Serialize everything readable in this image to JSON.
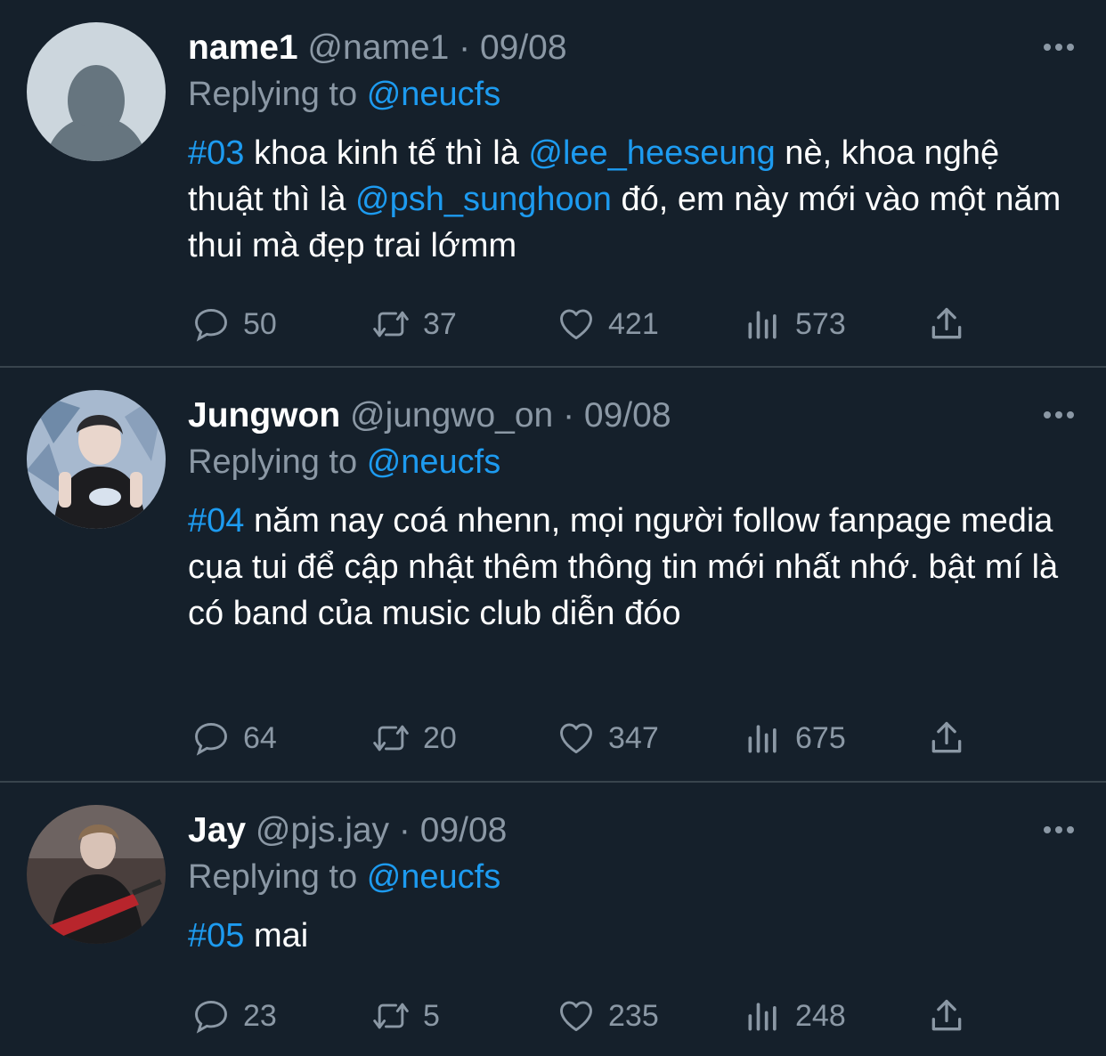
{
  "tweets": [
    {
      "name": "name1",
      "handle": "@name1",
      "separator": "·",
      "date": "09/08",
      "replying_prefix": "Replying to",
      "replying_to": "@neucfs",
      "body": [
        {
          "text": "#03",
          "link": true
        },
        {
          "text": " khoa kinh tế thì là ",
          "link": false
        },
        {
          "text": "@lee_heeseung",
          "link": true
        },
        {
          "text": " nè, khoa nghệ thuật thì là ",
          "link": false
        },
        {
          "text": "@psh_sunghoon",
          "link": true
        },
        {
          "text": " đó, em này mới vào một năm thui mà đẹp trai lớmm",
          "link": false
        }
      ],
      "stats": {
        "replies": "50",
        "retweets": "37",
        "likes": "421",
        "views": "573"
      }
    },
    {
      "name": "Jungwon",
      "handle": "@jungwo_on",
      "separator": "·",
      "date": "09/08",
      "replying_prefix": "Replying to",
      "replying_to": "@neucfs",
      "body": [
        {
          "text": "#04",
          "link": true
        },
        {
          "text": " năm nay coá nhenn, mọi người follow fanpage media cụa tui để cập nhật thêm thông tin mới nhất nhớ. bật mí là có band của music club diễn đóo",
          "link": false
        }
      ],
      "stats": {
        "replies": "64",
        "retweets": "20",
        "likes": "347",
        "views": "675"
      }
    },
    {
      "name": "Jay",
      "handle": "@pjs.jay",
      "separator": "·",
      "date": "09/08",
      "replying_prefix": "Replying to",
      "replying_to": "@neucfs",
      "body": [
        {
          "text": "#05",
          "link": true
        },
        {
          "text": " mai",
          "link": false
        }
      ],
      "stats": {
        "replies": "23",
        "retweets": "5",
        "likes": "235",
        "views": "248"
      }
    }
  ],
  "icons": {
    "reply": "reply-icon",
    "retweet": "retweet-icon",
    "like": "heart-icon",
    "views": "views-chart-icon",
    "share": "share-icon",
    "more": "more-dots-icon"
  },
  "colors": {
    "background": "#15202b",
    "muted": "#8b98a5",
    "link": "#1d9bf0",
    "divider": "#38444d",
    "text": "#ffffff"
  }
}
